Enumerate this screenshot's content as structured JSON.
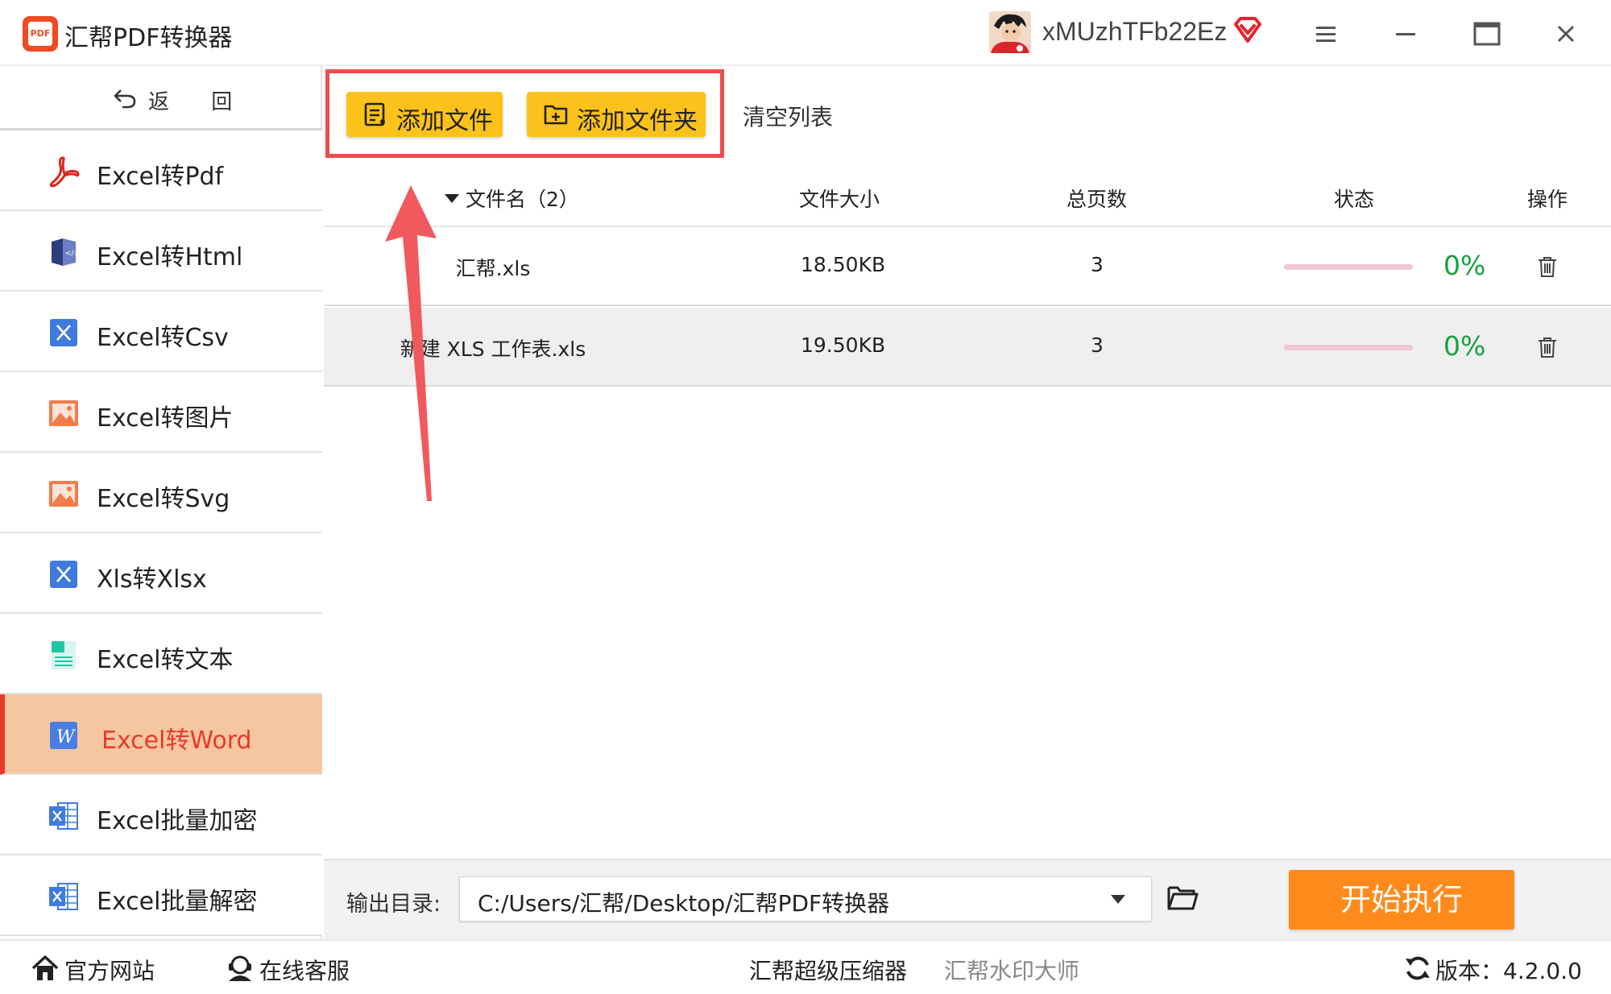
{
  "app": {
    "title": "汇帮PDF转换器",
    "logo_text": "PDF"
  },
  "user": {
    "name": "xMUzhTFb22Ez"
  },
  "icons": {
    "back": "undo-arrow-icon",
    "pdf": "adobe-pdf-icon",
    "html": "html-book-icon",
    "csv": "excel-x-icon",
    "image": "image-icon",
    "word": "word-w-icon",
    "encrypt": "excel-grid-icon",
    "trash": "trash-icon",
    "folder": "folder-open-icon",
    "home": "home-icon",
    "support": "headset-icon",
    "refresh": "refresh-icon",
    "vip": "vip-diamond-icon"
  },
  "colors": {
    "accent": "#e93a2a",
    "active_bg": "#f6c6a1",
    "button_yellow": "#fac21a",
    "start": "#ff8a1c",
    "percent_green": "#15a23a"
  },
  "sidebar": {
    "back_label": "返 回",
    "items": [
      {
        "label": "Excel转Pdf"
      },
      {
        "label": "Excel转Html"
      },
      {
        "label": "Excel转Csv"
      },
      {
        "label": "Excel转图片"
      },
      {
        "label": "Excel转Svg"
      },
      {
        "label": "Xls转Xlsx"
      },
      {
        "label": "Excel转文本"
      },
      {
        "label": "Excel转Word",
        "active": true
      },
      {
        "label": "Excel批量加密"
      },
      {
        "label": "Excel批量解密"
      }
    ]
  },
  "toolbar": {
    "add_file": "添加文件",
    "add_folder": "添加文件夹",
    "clear_list": "清空列表"
  },
  "table": {
    "headers": {
      "name": "文件名（2）",
      "size": "文件大小",
      "pages": "总页数",
      "status": "状态",
      "ops": "操作"
    },
    "rows": [
      {
        "name": "汇帮.xls",
        "size": "18.50KB",
        "pages": "3",
        "progress": 0,
        "percent": "0%"
      },
      {
        "name": "新建 XLS 工作表.xls",
        "size": "19.50KB",
        "pages": "3",
        "progress": 0,
        "percent": "0%"
      }
    ]
  },
  "output": {
    "label": "输出目录:",
    "path": "C:/Users/汇帮/Desktop/汇帮PDF转换器",
    "start_button": "开始执行"
  },
  "footer": {
    "website": "官方网站",
    "support": "在线客服",
    "compressor": "汇帮超级压缩器",
    "watermark": "汇帮水印大师",
    "version": "版本：4.2.0.0"
  }
}
